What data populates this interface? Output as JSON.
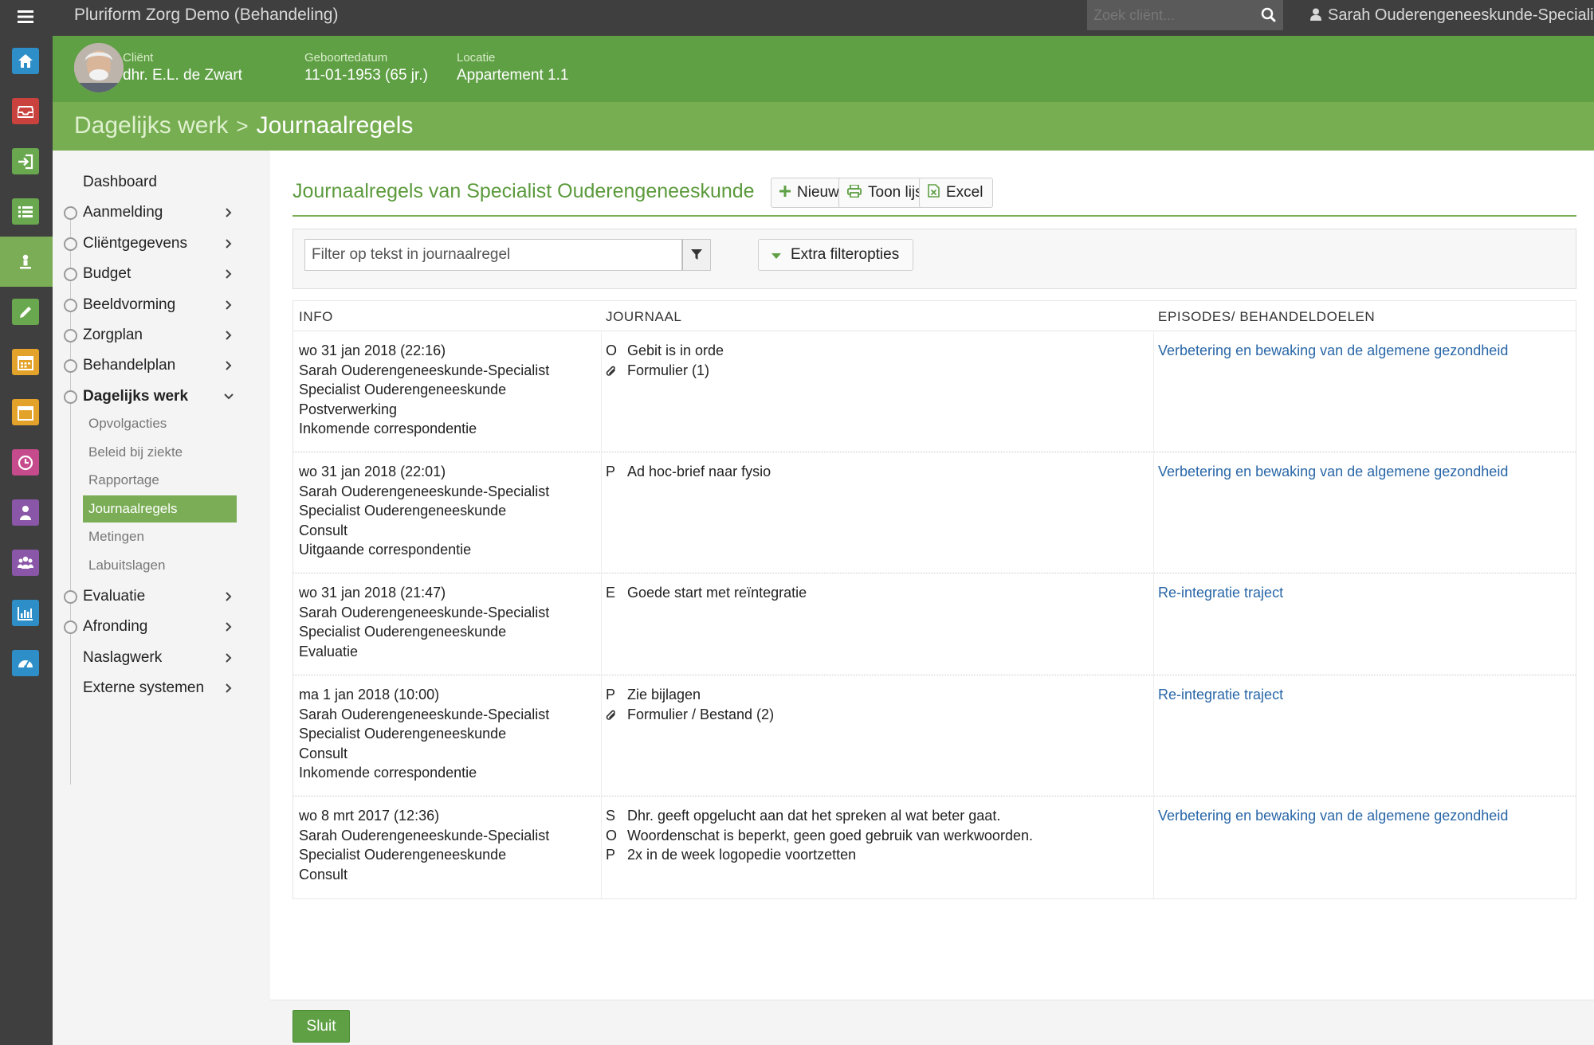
{
  "app": {
    "title": "Pluriform Zorg Demo  (Behandeling)",
    "search_placeholder": "Zoek cliënt...",
    "user": "Sarah Ouderengeneeskunde-Specialist"
  },
  "rail": [
    {
      "icon": "home-icon",
      "color": "#2e8fc8"
    },
    {
      "icon": "inbox-icon",
      "color": "#c9423e"
    },
    {
      "icon": "sign-in-icon",
      "color": "#6aa84f"
    },
    {
      "icon": "list-icon",
      "color": "#6aa84f"
    },
    {
      "icon": "client-icon",
      "color": "#7aad55"
    },
    {
      "icon": "pencil-icon",
      "color": "#6aa84f"
    },
    {
      "icon": "calendar-icon",
      "color": "#e3a32b"
    },
    {
      "icon": "calendar-empty-icon",
      "color": "#e3a32b"
    },
    {
      "icon": "clock-icon",
      "color": "#c54b8c"
    },
    {
      "icon": "user-icon",
      "color": "#8a56a8"
    },
    {
      "icon": "users-icon",
      "color": "#8a56a8"
    },
    {
      "icon": "bar-chart-icon",
      "color": "#2e8fc8"
    },
    {
      "icon": "dashboard-icon",
      "color": "#2e8fc8"
    }
  ],
  "client": {
    "client_label": "Cliënt",
    "client_name": "dhr. E.L. de Zwart",
    "dob_label": "Geboortedatum",
    "dob": "11-01-1953 (65 jr.)",
    "location_label": "Locatie",
    "location": "Appartement 1.1"
  },
  "breadcrumb": {
    "parent": "Dagelijks werk",
    "separator": ">",
    "current": "Journaalregels"
  },
  "nav": {
    "items": [
      {
        "label": "Dashboard",
        "dot": false,
        "chevron": ""
      },
      {
        "label": "Aanmelding",
        "dot": true,
        "chevron": ">"
      },
      {
        "label": "Cliëntgegevens",
        "dot": true,
        "chevron": ">"
      },
      {
        "label": "Budget",
        "dot": true,
        "chevron": ">"
      },
      {
        "label": "Beeldvorming",
        "dot": true,
        "chevron": ">"
      },
      {
        "label": "Zorgplan",
        "dot": true,
        "chevron": ">"
      },
      {
        "label": "Behandelplan",
        "dot": true,
        "chevron": ">"
      },
      {
        "label": "Dagelijks werk",
        "dot": true,
        "chevron": "v"
      }
    ],
    "sub_items": [
      "Opvolgacties",
      "Beleid bij ziekte",
      "Rapportage",
      "Journaalregels",
      "Metingen",
      "Labuitslagen"
    ],
    "after_items": [
      {
        "label": "Evaluatie",
        "dot": true,
        "chevron": ">"
      },
      {
        "label": "Afronding",
        "dot": true,
        "chevron": ">"
      },
      {
        "label": "Naslagwerk",
        "dot": false,
        "chevron": ">"
      },
      {
        "label": "Externe systemen",
        "dot": false,
        "chevron": ">"
      }
    ]
  },
  "main": {
    "title": "Journaalregels van Specialist Ouderengeneeskunde",
    "btn_new": "Nieuw",
    "btn_list": "Toon lijst",
    "btn_excel": "Excel",
    "filter_placeholder": "Filter op tekst in journaalregel",
    "extra_filter": "Extra filteropties",
    "columns": [
      "INFO",
      "JOURNAAL",
      "EPISODES/ BEHANDELDOELEN"
    ]
  },
  "rows": [
    {
      "info": [
        "wo 31 jan 2018 (22:16)",
        "Sarah Ouderengeneeskunde-Specialist",
        "Specialist Ouderengeneeskunde",
        "Postverwerking",
        "Inkomende correspondentie"
      ],
      "journal": [
        {
          "code": "O",
          "text": "Gebit is in orde"
        },
        {
          "code": "paperclip",
          "text": "Formulier (1)"
        }
      ],
      "goal": "Verbetering en bewaking van de algemene gezondheid"
    },
    {
      "info": [
        "wo 31 jan 2018 (22:01)",
        "Sarah Ouderengeneeskunde-Specialist",
        "Specialist Ouderengeneeskunde",
        "Consult",
        "Uitgaande correspondentie"
      ],
      "journal": [
        {
          "code": "P",
          "text": "Ad hoc-brief naar fysio"
        }
      ],
      "goal": "Verbetering en bewaking van de algemene gezondheid"
    },
    {
      "info": [
        "wo 31 jan 2018 (21:47)",
        "Sarah Ouderengeneeskunde-Specialist",
        "Specialist Ouderengeneeskunde",
        "Evaluatie"
      ],
      "journal": [
        {
          "code": "E",
          "text": "Goede start met reïntegratie"
        }
      ],
      "goal": "Re-integratie traject"
    },
    {
      "info": [
        "ma 1 jan 2018 (10:00)",
        "Sarah Ouderengeneeskunde-Specialist",
        "Specialist Ouderengeneeskunde",
        "Consult",
        "Inkomende correspondentie"
      ],
      "journal": [
        {
          "code": "P",
          "text": "Zie bijlagen"
        },
        {
          "code": "paperclip",
          "text": "Formulier / Bestand (2)"
        }
      ],
      "goal": "Re-integratie traject"
    },
    {
      "info": [
        "wo 8 mrt 2017 (12:36)",
        "Sarah Ouderengeneeskunde-Specialist",
        "Specialist Ouderengeneeskunde",
        "Consult"
      ],
      "journal": [
        {
          "code": "S",
          "text": "Dhr. geeft opgelucht aan dat het spreken al wat beter gaat."
        },
        {
          "code": "O",
          "text": "Woordenschat is beperkt, geen goed gebruik van werkwoorden."
        },
        {
          "code": "P",
          "text": "2x in de week logopedie voortzetten"
        }
      ],
      "goal": "Verbetering en bewaking van de algemene gezondheid"
    }
  ],
  "footer": {
    "close": "Sluit"
  }
}
